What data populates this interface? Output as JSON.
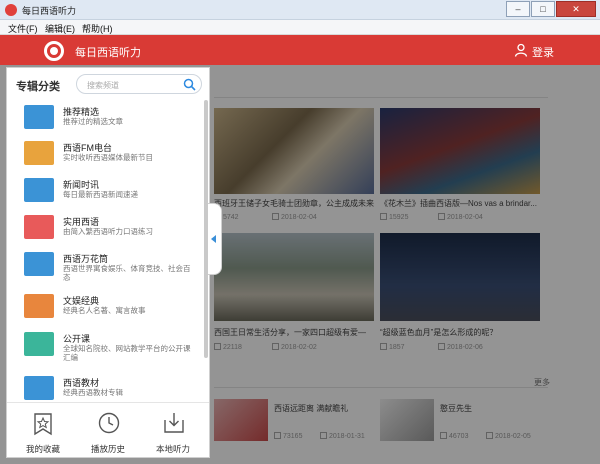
{
  "window": {
    "title": "每日西语听力",
    "buttons": [
      "–",
      "□",
      "✕"
    ]
  },
  "menu": {
    "items": [
      "文件(F)",
      "编辑(E)",
      "帮助(H)"
    ]
  },
  "appbar": {
    "name": "每日西语听力",
    "login": "登录"
  },
  "drawer": {
    "heading": "专辑分类",
    "search_placeholder": "搜索频道",
    "items": [
      {
        "title": "推荐精选",
        "desc": "推荐过的精选文章",
        "icon": "recommend-icon",
        "color": "#3b93d6"
      },
      {
        "title": "西语FM电台",
        "desc": "实时收听西语媒体最新节目",
        "icon": "radio-icon",
        "color": "#e8a33d"
      },
      {
        "title": "新闻时讯",
        "desc": "每日最新西语新闻速递",
        "icon": "news-icon",
        "color": "#3b93d6"
      },
      {
        "title": "实用西语",
        "desc": "由简入繁西语听力口语练习",
        "icon": "shop-icon",
        "color": "#e85a5a"
      },
      {
        "title": "西语万花筒",
        "desc": "西语世界寓食娱乐、体育竞技、社会百态",
        "icon": "picture-icon",
        "color": "#3b93d6"
      },
      {
        "title": "文娱经典",
        "desc": "经典名人名著、寓言故事",
        "icon": "book-icon",
        "color": "#e8863d"
      },
      {
        "title": "公开课",
        "desc": "全球知名院校、网站教学平台的公开课汇编",
        "icon": "graduation-cap-icon",
        "color": "#3bb59a"
      },
      {
        "title": "西语教材",
        "desc": "经典西语教材专辑",
        "icon": "textbook-icon",
        "color": "#3b93d6"
      }
    ],
    "bottom": [
      {
        "label": "我的收藏",
        "icon": "favorite-icon"
      },
      {
        "label": "播放历史",
        "icon": "history-icon"
      },
      {
        "label": "本地听力",
        "icon": "download-icon"
      }
    ]
  },
  "content": {
    "cards": [
      {
        "title": "西班牙王储子女毛骑士团勋章，公主成成未来...",
        "views": "5742",
        "date": "2018-02-04"
      },
      {
        "title": "《花木兰》插曲西语版—Nos vas a brindar...",
        "views": "15925",
        "date": "2018-02-04"
      },
      {
        "title": "西国王日常生活分享，一家四口超级有爱—",
        "views": "22118",
        "date": "2018-02-02"
      },
      {
        "title": "“超级蓝色血月”是怎么形成的呢？",
        "views": "1857",
        "date": "2018-02-06"
      },
      {
        "title": "西语远距离 满献瞻礼",
        "views": "73165",
        "date": "2018-01-31"
      },
      {
        "title": "憨豆先生",
        "views": "46703",
        "date": "2018-02-05"
      }
    ],
    "more": "更多"
  }
}
